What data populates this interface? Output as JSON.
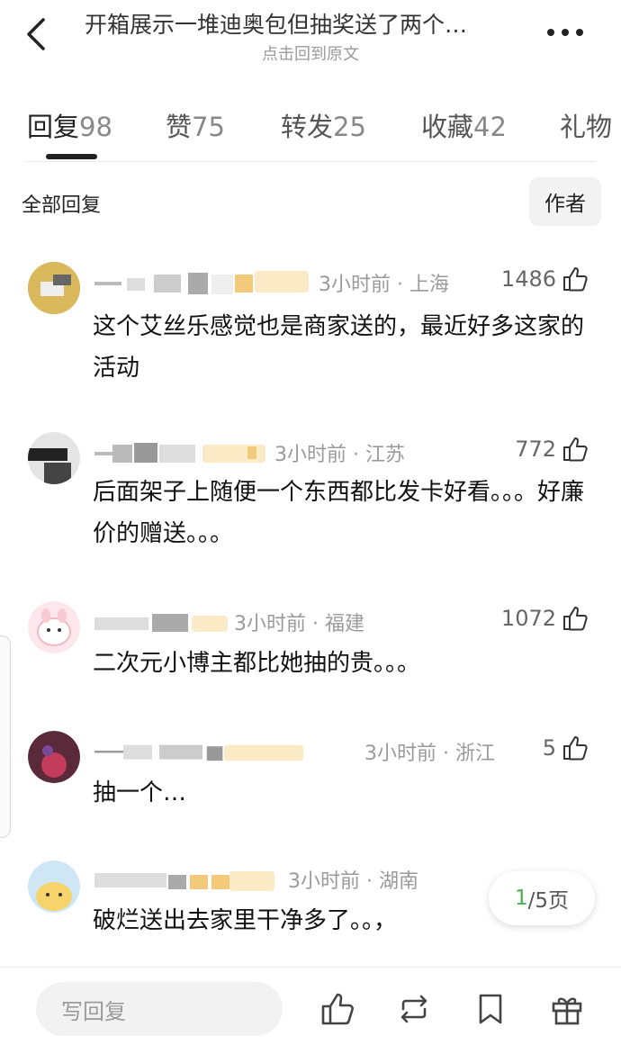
{
  "header": {
    "title": "开箱展示一堆迪奥包但抽奖送了两个…",
    "subtitle": "点击回到原文"
  },
  "tabs": [
    {
      "label": "回复",
      "count": "98"
    },
    {
      "label": "赞",
      "count": "75"
    },
    {
      "label": "转发",
      "count": "25"
    },
    {
      "label": "收藏",
      "count": "42"
    },
    {
      "label": "礼物",
      "count": ""
    }
  ],
  "filter": {
    "all_label": "全部回复",
    "author_label": "作者"
  },
  "comments": [
    {
      "meta": "3小时前 · 上海",
      "likes": "1486",
      "text": "这个艾丝乐感觉也是商家送的，最近好多这家的活动"
    },
    {
      "meta": "3小时前 · 江苏",
      "likes": "772",
      "text": "后面架子上随便一个东西都比发卡好看。。。好廉价的赠送。。。"
    },
    {
      "meta": "3小时前 · 福建",
      "likes": "1072",
      "text": "二次元小博主都比她抽的贵。。。"
    },
    {
      "meta": "3小时前 · 浙江",
      "likes": "5",
      "text": "抽一个…"
    },
    {
      "meta": "3小时前 · 湖南",
      "likes": "",
      "text": "破烂送出去家里干净多了。。，"
    }
  ],
  "pager": {
    "current": "1",
    "total_label": "/5页"
  },
  "bottom": {
    "reply_placeholder": "写回复"
  },
  "colors": {
    "accent": "#4caf50",
    "meta": "#9a9a9a"
  }
}
